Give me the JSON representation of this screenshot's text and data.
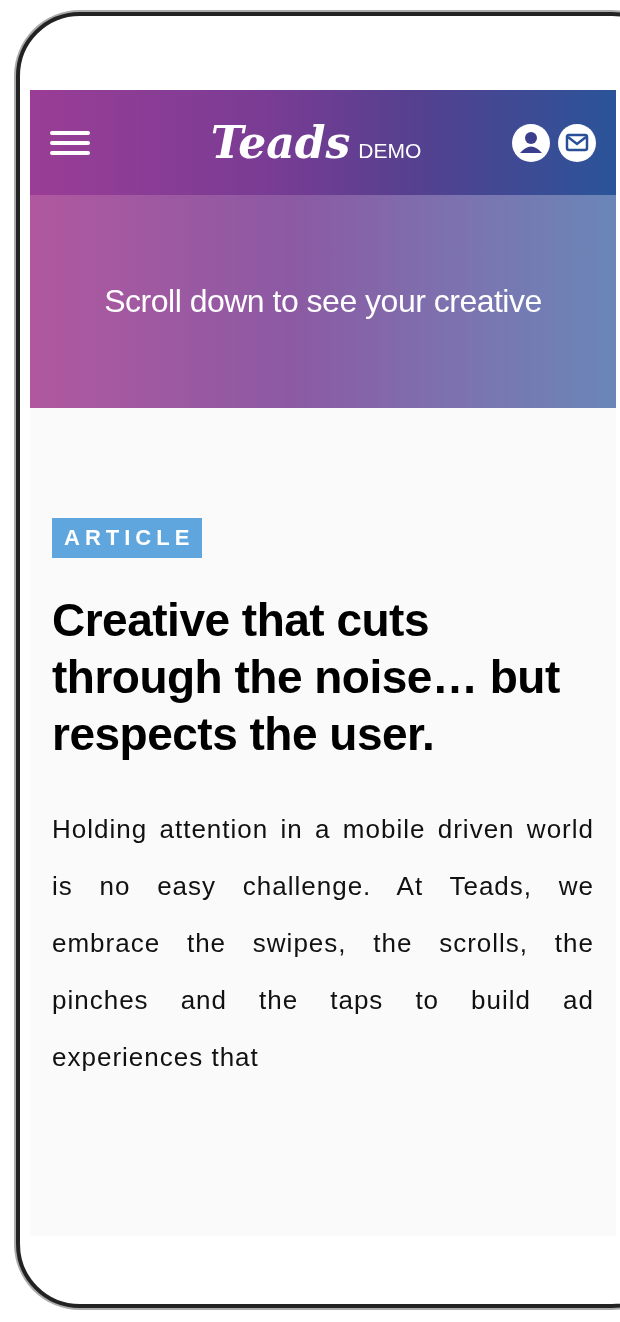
{
  "header": {
    "logo": "Teads",
    "logo_suffix": "DEMO"
  },
  "hero": {
    "text": "Scroll down to see your creative"
  },
  "article": {
    "tag": "ARTICLE",
    "title": "Creative that cuts through the noise… but respects the user.",
    "body": "Holding attention in a mobile driven world is no easy challenge. At Teads, we embrace the swipes, the scrolls, the pinches and the taps to build ad experiences that"
  }
}
